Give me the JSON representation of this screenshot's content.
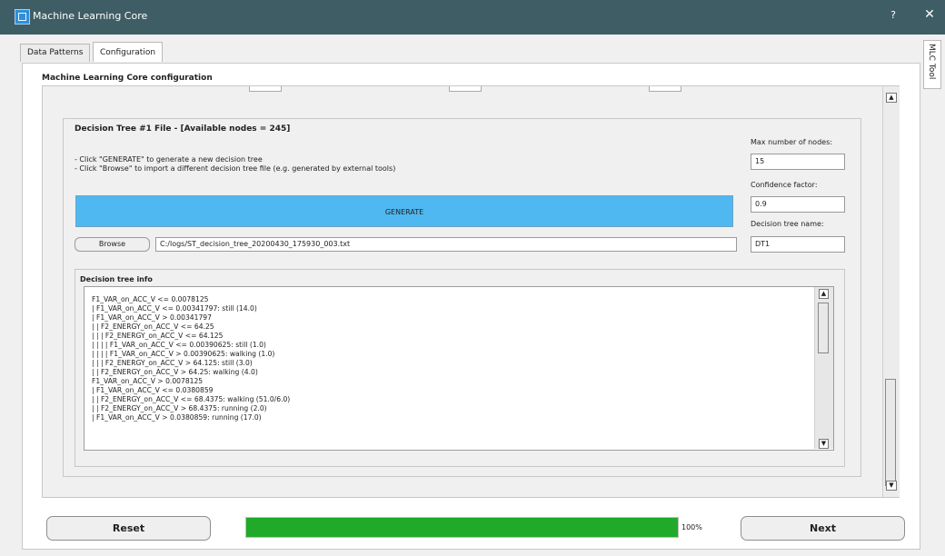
{
  "window": {
    "title": "Machine Learning Core",
    "help_glyph": "?",
    "close_glyph": "✕",
    "side_tab": "MLC Tool"
  },
  "tabs": [
    {
      "label": "Data Patterns",
      "active": false
    },
    {
      "label": "Configuration",
      "active": true
    }
  ],
  "section": {
    "title": "Machine Learning Core configuration"
  },
  "decision_tree": {
    "group_title": "Decision Tree #1 File   -   [Available nodes = 245]",
    "instructions": [
      "- Click \"GENERATE\" to generate a new decision tree",
      "- Click \"Browse\" to import a different decision tree file (e.g. generated by external tools)"
    ],
    "generate_label": "GENERATE",
    "browse_label": "Browse",
    "file_path": "C:/logs/ST_decision_tree_20200430_175930_003.txt",
    "settings": {
      "max_nodes_label": "Max number of nodes:",
      "max_nodes_value": "15",
      "confidence_label": "Confidence factor:",
      "confidence_value": "0.9",
      "tree_name_label": "Decision tree name:",
      "tree_name_value": "DT1"
    },
    "info_title": "Decision tree info",
    "tree_lines": [
      "F1_VAR_on_ACC_V <= 0.0078125",
      "|  F1_VAR_on_ACC_V <= 0.00341797: still (14.0)",
      "|  F1_VAR_on_ACC_V > 0.00341797",
      "|  |  F2_ENERGY_on_ACC_V <= 64.25",
      "|  |  |  F2_ENERGY_on_ACC_V <= 64.125",
      "|  |  |  |  F1_VAR_on_ACC_V <= 0.00390625: still (1.0)",
      "|  |  |  |  F1_VAR_on_ACC_V > 0.00390625: walking (1.0)",
      "|  |  |  F2_ENERGY_on_ACC_V > 64.125: still (3.0)",
      "|  |  F2_ENERGY_on_ACC_V > 64.25: walking (4.0)",
      "F1_VAR_on_ACC_V > 0.0078125",
      "|  F1_VAR_on_ACC_V <= 0.0380859",
      "|  |  F2_ENERGY_on_ACC_V <= 68.4375: walking (51.0/6.0)",
      "|  |  F2_ENERGY_on_ACC_V > 68.4375: running (2.0)",
      "|  F1_VAR_on_ACC_V > 0.0380859: running (17.0)"
    ]
  },
  "footer": {
    "reset_label": "Reset",
    "next_label": "Next",
    "progress_value": 1.0,
    "progress_text": "100%"
  },
  "colors": {
    "title_bar": "#3f5d64",
    "generate_button": "#4fb8f0",
    "progress_fill": "#21aa29"
  },
  "icons": {
    "app": "window-app-icon",
    "scroll_up": "chevron-up-icon",
    "scroll_down": "chevron-down-icon"
  }
}
